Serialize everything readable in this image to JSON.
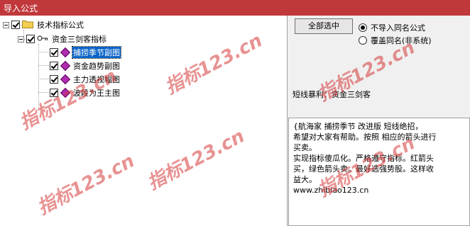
{
  "window": {
    "title": "导入公式"
  },
  "tree": {
    "root": {
      "label": "技术指标公式"
    },
    "group": {
      "label": "资金三剑客指标"
    },
    "items": [
      {
        "label": "捕捞季节副图",
        "selected": true
      },
      {
        "label": "资金趋势副图",
        "selected": false
      },
      {
        "label": "主力透视幅图",
        "selected": false
      },
      {
        "label": "波段为王主图",
        "selected": false
      }
    ]
  },
  "controls": {
    "select_all_label": "全部选中",
    "radio_options": [
      {
        "label": "不导入同名公式",
        "checked": true
      },
      {
        "label": "覆盖同名(非系统)",
        "checked": false
      }
    ]
  },
  "info": {
    "line": "短线暴利：资金三剑客"
  },
  "description": {
    "lines": [
      "{航海家 捕捞季节 改进版 短线绝招，",
      "希望对大家有帮助。按照 相应的箭头进行",
      "买卖。",
      "实现指标傻瓜化。严格遵守指标。红箭头",
      "买，绿色箭头卖。最好选强势股。这样收",
      "益大。",
      "www.zhibiao123.cn"
    ]
  },
  "watermark": {
    "text": "指标123.cn"
  },
  "colors": {
    "title_bar": "#c0383a",
    "selection": "#0a64c8",
    "watermark": "#d63a3a"
  }
}
